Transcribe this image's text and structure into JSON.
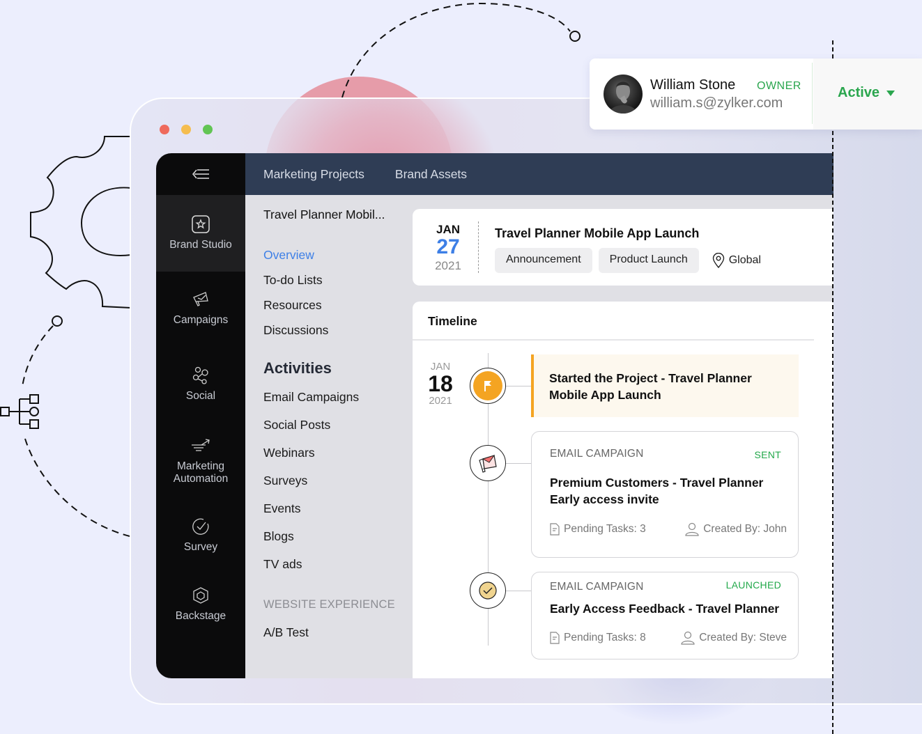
{
  "window": {
    "controls": [
      "close",
      "minimize",
      "maximize"
    ]
  },
  "rail": {
    "toggle_icon": "collapse-menu-icon",
    "items": [
      {
        "label": "Brand Studio",
        "icon": "star-badge-icon",
        "active": true
      },
      {
        "label": "Campaigns",
        "icon": "megaphone-icon",
        "active": false
      },
      {
        "label": "Social",
        "icon": "share-nodes-icon",
        "active": false
      },
      {
        "label": "Marketing Automation",
        "label_line1": "Marketing",
        "label_line2": "Automation",
        "icon": "funnel-arrow-icon",
        "active": false
      },
      {
        "label": "Survey",
        "icon": "check-circle-icon",
        "active": false
      },
      {
        "label": "Backstage",
        "icon": "cube-icon",
        "active": false
      }
    ]
  },
  "topbar": {
    "tabs": [
      {
        "label": "Marketing Projects"
      },
      {
        "label": "Brand Assets"
      }
    ]
  },
  "subnav": {
    "project_name": "Travel Planner Mobil...",
    "items": [
      {
        "label": "Overview",
        "active": true
      },
      {
        "label": "To-do Lists",
        "active": false
      },
      {
        "label": "Resources",
        "active": false
      },
      {
        "label": "Discussions",
        "active": false
      }
    ],
    "activities_heading": "Activities",
    "activities": [
      {
        "label": "Email Campaigns"
      },
      {
        "label": "Social Posts"
      },
      {
        "label": "Webinars"
      },
      {
        "label": "Surveys"
      },
      {
        "label": "Events"
      },
      {
        "label": "Blogs"
      },
      {
        "label": "TV ads"
      }
    ],
    "website_heading": "WEBSITE EXPERIENCE",
    "website_items": [
      {
        "label": "A/B Test"
      }
    ]
  },
  "project_header": {
    "month": "JAN",
    "day": "27",
    "year": "2021",
    "title": "Travel Planner Mobile App Launch",
    "tags": [
      "Announcement",
      "Product Launch"
    ],
    "location": "Global",
    "accent_color": "#3d7fe6"
  },
  "timeline": {
    "title": "Timeline",
    "date": {
      "month": "JAN",
      "day": "18",
      "year": "2021"
    },
    "events": [
      {
        "kind": "milestone",
        "icon": "flag-icon",
        "title_line1": "Started the Project - Travel Planner",
        "title_line2": "Mobile App Launch",
        "accent_color": "#f4a422"
      },
      {
        "kind": "campaign",
        "icon": "email-megaphone-icon",
        "type": "EMAIL CAMPAIGN",
        "status": "SENT",
        "title_line1": "Premium Customers - Travel Planner",
        "title_line2": "Early access invite",
        "pending_tasks": "Pending Tasks: 3",
        "created_by": "Created By: John"
      },
      {
        "kind": "campaign",
        "icon": "check-badge-icon",
        "type": "EMAIL CAMPAIGN",
        "status": "LAUNCHED",
        "title_line1": "Early Access Feedback - Travel Planner",
        "pending_tasks": "Pending Tasks: 8",
        "created_by": "Created By: Steve"
      }
    ],
    "status_color": "#22a84a"
  },
  "owner_card": {
    "name": "William Stone",
    "role": "OWNER",
    "email": "william.s@zylker.com",
    "status": "Active",
    "status_color": "#2aa64e"
  }
}
